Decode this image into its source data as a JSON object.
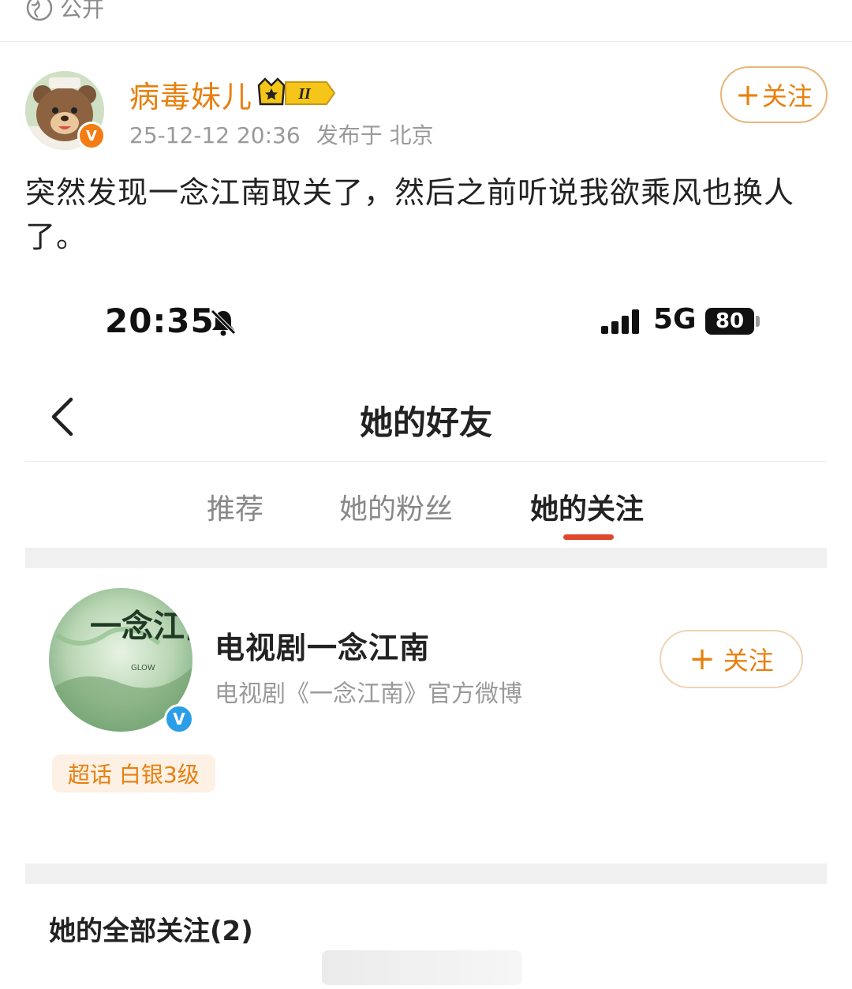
{
  "post": {
    "visibility": "公开",
    "author": "病毒妹儿",
    "vip_level": "II",
    "timestamp": "25-12-12 20:36",
    "location": "发布于 北京",
    "follow_label": "关注",
    "text": "突然发现一念江南取关了，然后之前听说我欲乘风也换人了。"
  },
  "screenshot": {
    "status_bar": {
      "time": "20:35",
      "network": "5G",
      "battery": "80"
    },
    "nav": {
      "title": "她的好友"
    },
    "tabs": [
      {
        "label": "推荐",
        "active": false
      },
      {
        "label": "她的粉丝",
        "active": false
      },
      {
        "label": "她的关注",
        "active": true
      }
    ],
    "account": {
      "name": "电视剧一念江南",
      "description": "电视剧《一念江南》官方微博",
      "tag": "超话 白银3级",
      "follow_label": "关注",
      "avatar_text": "一念江南",
      "avatar_subtext": "GLOW"
    },
    "section_title": "她的全部关注(2)"
  },
  "colors": {
    "accent_orange": "#e8800f",
    "tab_indicator": "#e0482b",
    "verified_blue": "#2a9ee8"
  }
}
